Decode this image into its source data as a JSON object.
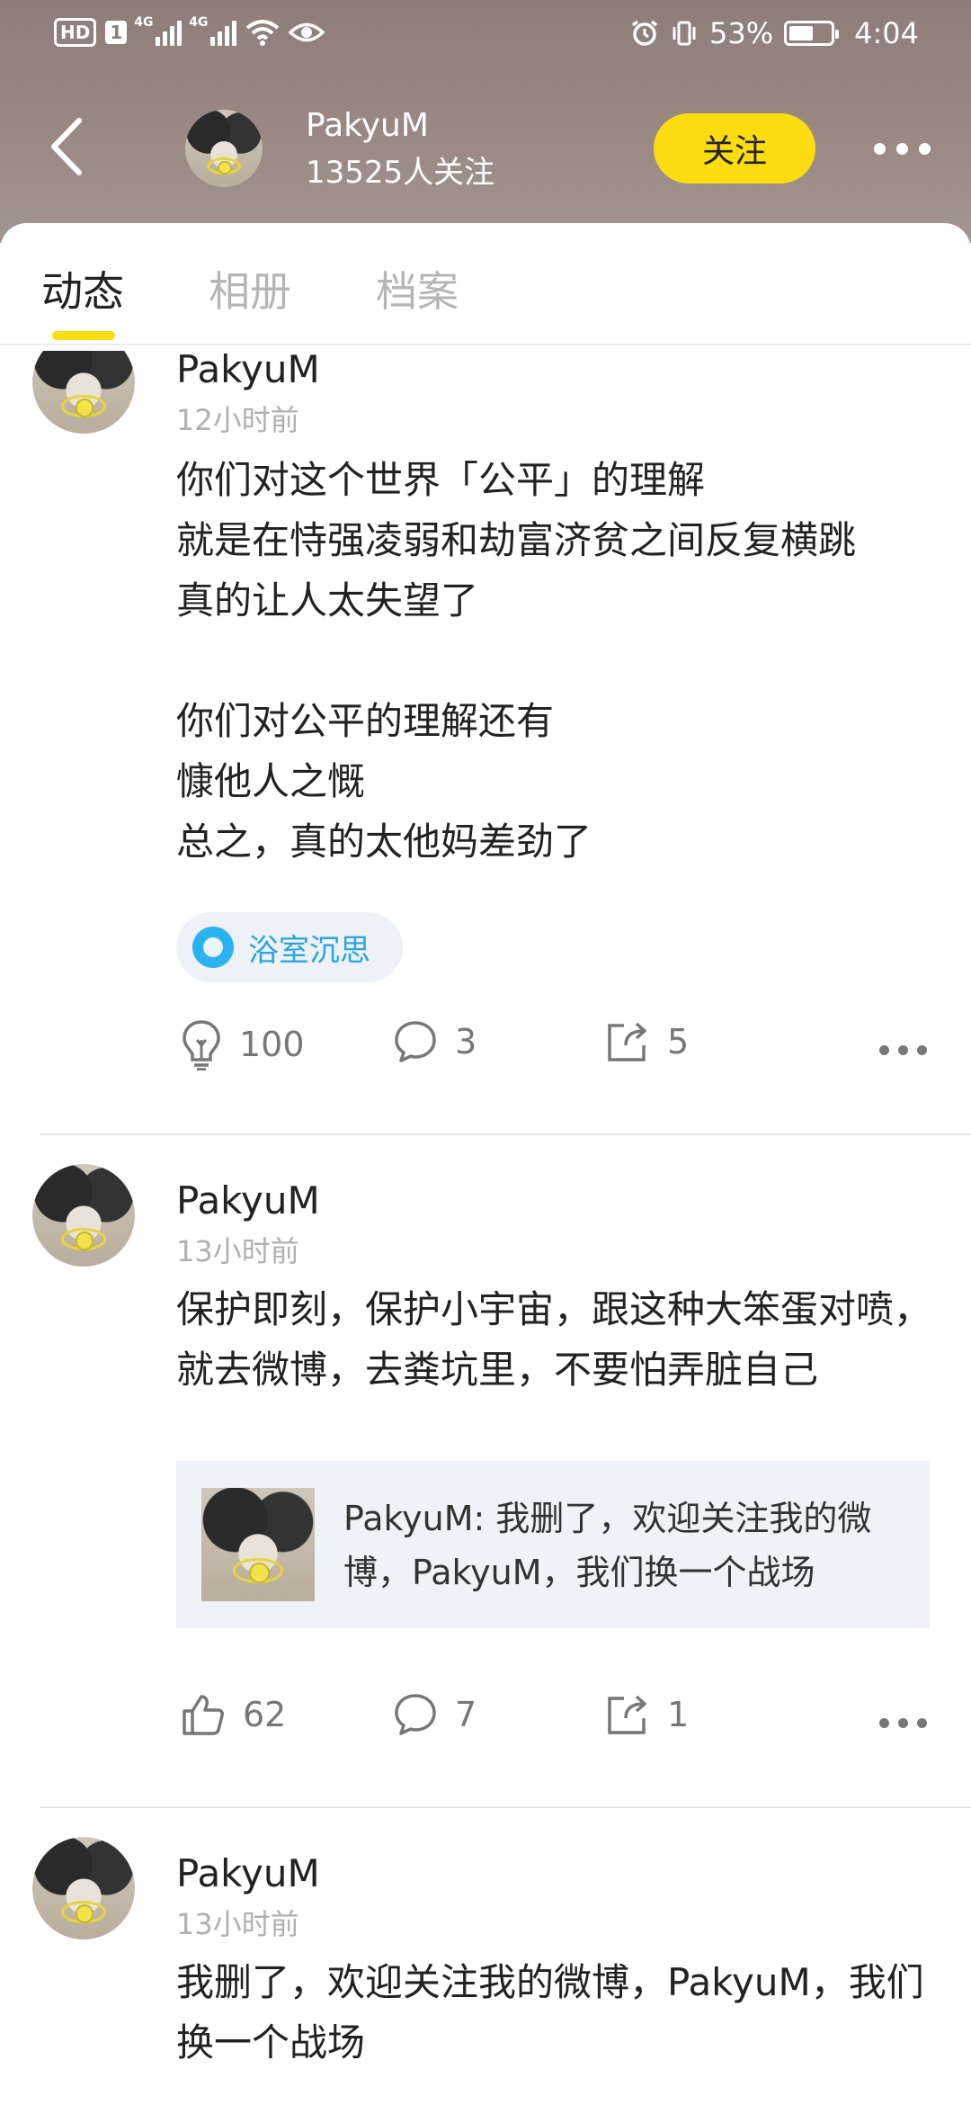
{
  "status_bar": {
    "hd": "HD",
    "sim": "1",
    "net1": "4G",
    "net2": "4G",
    "battery_pct": "53%",
    "time": "4:04",
    "icons": [
      "wifi-icon",
      "eye-icon",
      "alarm-icon",
      "vibrate-icon",
      "battery-icon"
    ]
  },
  "header": {
    "name": "PakyuM",
    "followers": "13525人关注",
    "follow_label": "关注",
    "accent": "#fbdc10"
  },
  "tabs": [
    {
      "label": "动态",
      "active": true
    },
    {
      "label": "相册",
      "active": false
    },
    {
      "label": "档案",
      "active": false
    }
  ],
  "posts": [
    {
      "name": "PakyuM",
      "time": "12小时前",
      "text": "你们对这个世界「公平」的理解\n就是在恃强凌弱和劫富济贫之间反复横跳\n真的让人太失望了\n\n你们对公平的理解还有\n慷他人之慨\n总之，真的太他妈差劲了",
      "topic": "浴室沉思",
      "like_icon": "lightbulb-icon",
      "likes": "100",
      "comments": "3",
      "shares": "5"
    },
    {
      "name": "PakyuM",
      "time": "13小时前",
      "text": "保护即刻，保护小宇宙，跟这种大笨蛋对喷，就去微博，去粪坑里，不要怕弄脏自己",
      "quote": "PakyuM: 我删了，欢迎关注我的微博，PakyuM，我们换一个战场",
      "like_icon": "thumbs-up-icon",
      "likes": "62",
      "comments": "7",
      "shares": "1"
    },
    {
      "name": "PakyuM",
      "time": "13小时前",
      "text": "我删了，欢迎关注我的微博，PakyuM，我们换一个战场"
    }
  ]
}
